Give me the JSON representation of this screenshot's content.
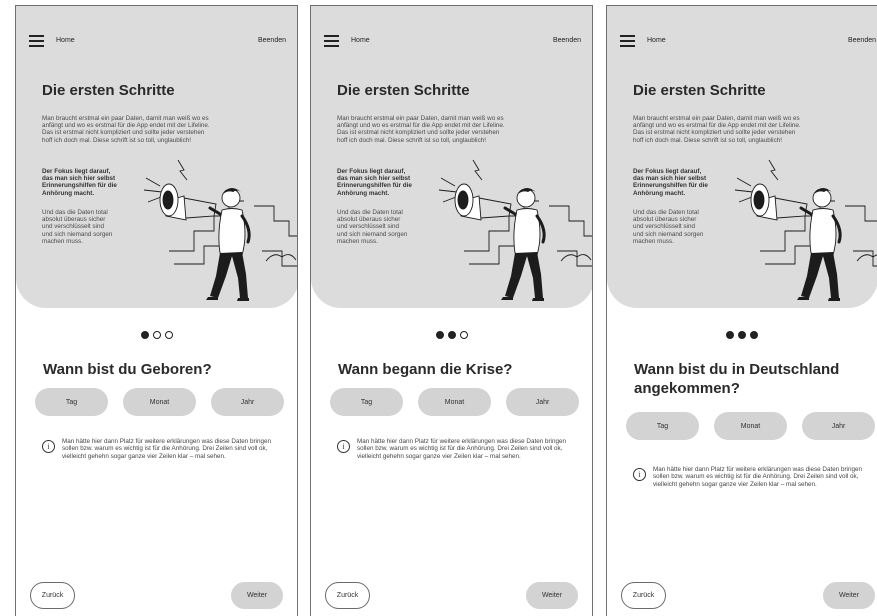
{
  "header": {
    "home_label": "Home",
    "end_label": "Beenden"
  },
  "hero": {
    "title": "Die ersten Schritte",
    "text1": "Man braucht erstmal ein paar Daten, damit man weiß wo es anfängt und wo es erstmal für die App endet mit der Lifeline. Das ist erstmal nicht kompliziert und sollte jeder verstehen hoff ich doch mal. Diese schrift ist so toll, unglaublich!",
    "text2": "Der Fokus liegt darauf, das man sich hier selbst Erinnerungshilfen für die Anhörung macht.",
    "text3": "Und das die Daten total absolut überaus sicher und verschlüsselt sind und sich niemand sorgen machen muss.",
    "illustration": "person-with-megaphone-illustration"
  },
  "fields": {
    "day": "Tag",
    "month": "Monat",
    "year": "Jahr"
  },
  "info": {
    "icon": "info-icon",
    "text": "Man hätte hier dann Platz für weitere erklärungen was diese Daten bringen sollen bzw. warum es wichtig ist für die Anhörung. Drei Zeilen sind voll ok, vielleicht gehehn sogar ganze vier Zeilen klar – mal sehen."
  },
  "nav": {
    "back_label": "Zurück",
    "next_label": "Weiter"
  },
  "screens": [
    {
      "question": "Wann bist du Geboren?",
      "step": 1,
      "total_steps": 3
    },
    {
      "question": "Wann begann die Krise?",
      "step": 2,
      "total_steps": 3
    },
    {
      "question": "Wann bist du in Deutschland angekommen?",
      "step": 3,
      "total_steps": 3
    }
  ],
  "colors": {
    "hero_bg": "#dcdcdc",
    "pill_bg": "#d3d3d3",
    "text_dark": "#2a2a2a"
  }
}
